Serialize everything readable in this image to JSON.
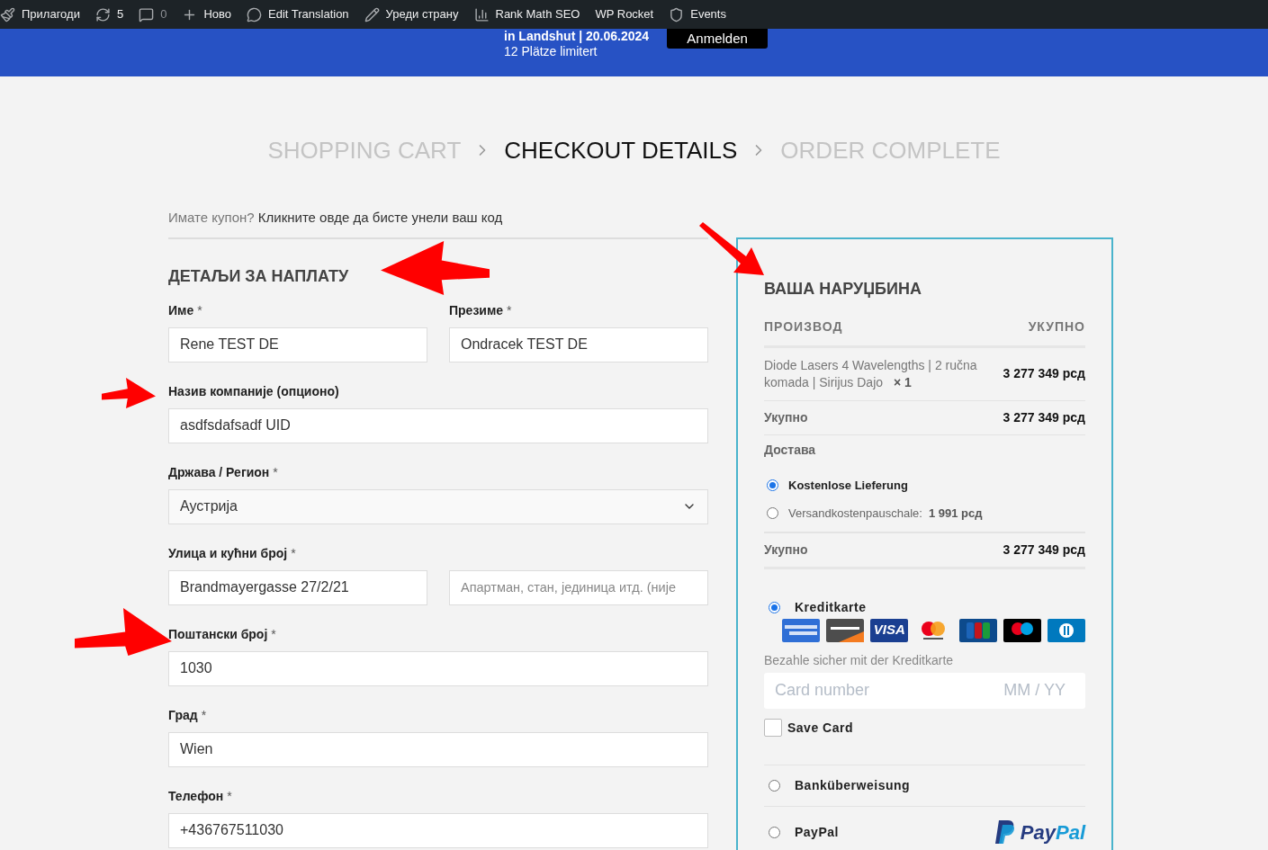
{
  "admin_bar": [
    {
      "label": "Прилагоди",
      "disabled": false
    },
    {
      "label": "5",
      "disabled": false
    },
    {
      "label": "0",
      "disabled": true
    },
    {
      "label": "Ново",
      "disabled": false
    },
    {
      "label": "Edit Translation",
      "disabled": false
    },
    {
      "label": "Уреди страну",
      "disabled": false
    },
    {
      "label": "Rank Math SEO",
      "disabled": false
    },
    {
      "label": "WP Rocket",
      "disabled": false
    },
    {
      "label": "Events",
      "disabled": false
    }
  ],
  "banner": {
    "headline": "in Landshut | 20.06.2024",
    "subline": "12 Plätze limitert",
    "button": "Anmelden"
  },
  "steps": [
    {
      "label": "SHOPPING CART",
      "selected": false
    },
    {
      "label": "CHECKOUT DETAILS",
      "selected": true
    },
    {
      "label": "ORDER COMPLETE",
      "selected": false
    }
  ],
  "coupon": {
    "prompt": "Имате купон?",
    "link": "Кликните овде да бисте унели ваш код"
  },
  "billing": {
    "title": "ДЕТАЉИ ЗА НАПЛАТУ",
    "rows": [
      [
        {
          "kind": "input",
          "label": "Име",
          "asterisk": "*",
          "value": "Rene TEST DE"
        },
        {
          "kind": "input",
          "label": "Презиме",
          "asterisk": "*",
          "value": "Ondracek TEST DE"
        }
      ],
      [
        {
          "kind": "input",
          "label": "Назив компаније (опционо)",
          "value": "asdfsdafsadf UID"
        }
      ],
      [
        {
          "kind": "select",
          "label": "Држава / Регион",
          "asterisk": "*",
          "value": "Аустрија"
        }
      ],
      [
        {
          "kind": "input",
          "label": "Улица и кућни број",
          "asterisk": "*",
          "value": "Brandmayergasse 27/2/21"
        },
        {
          "kind": "input",
          "placeholder": "Апартман, стан, јединица итд. (није"
        }
      ],
      [
        {
          "kind": "input",
          "label": "Поштански број",
          "asterisk": "*",
          "value": "1030"
        }
      ],
      [
        {
          "kind": "input",
          "label": "Град",
          "asterisk": "*",
          "value": "Wien"
        }
      ],
      [
        {
          "kind": "input",
          "label": "Телефон",
          "asterisk": "*",
          "value": "+436767511030"
        }
      ]
    ]
  },
  "order": {
    "title": "ВАША НАРУЏБИНА",
    "columns": [
      "ПРОИЗВОД",
      "УКУПНО"
    ],
    "product": {
      "name": "Diode Lasers 4 Wavelengths | 2 ručna komada | Sirijus Dajo",
      "qty": "× 1",
      "total": "3 277 349 рсд"
    },
    "subtotal": {
      "label": "Укупно",
      "value": "3 277 349 рсд"
    },
    "shipping": {
      "label": "Достава",
      "options": [
        {
          "label": "Kostenlose Lieferung",
          "selected": true
        },
        {
          "label": "Versandkostenpauschale:",
          "price": "1 991 рсд",
          "selected": false
        }
      ]
    },
    "total": {
      "label": "Укупно",
      "value": "3 277 349 рсд"
    }
  },
  "payment": {
    "methods": [
      {
        "kind": "card",
        "label": "Kreditkarte",
        "selected": true
      },
      {
        "kind": "plain",
        "label": "Banküberweisung",
        "selected": false
      },
      {
        "kind": "paypal",
        "label": "PayPal",
        "selected": false,
        "logo": "PayPal"
      }
    ],
    "cards": [
      {
        "kind": "amex"
      },
      {
        "kind": "discover"
      },
      {
        "kind": "visa",
        "text": "VISA"
      },
      {
        "kind": "mastercard"
      },
      {
        "kind": "jcb"
      },
      {
        "kind": "maestro"
      },
      {
        "kind": "diners"
      }
    ],
    "description": "Bezahle sicher mit der Kreditkarte",
    "card_number": {
      "placeholder": "Card number"
    },
    "expiry": {
      "placeholder": "MM / YY"
    },
    "save_card": {
      "label": "Save Card",
      "checked": false
    }
  }
}
